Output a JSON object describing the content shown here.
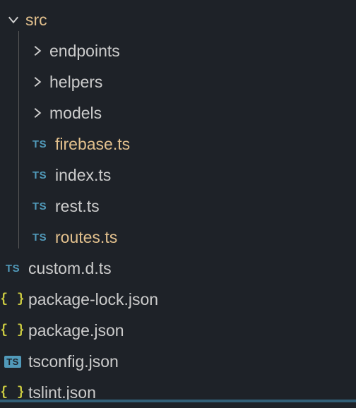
{
  "tree": {
    "src": {
      "label": "src",
      "folders": [
        {
          "label": "endpoints"
        },
        {
          "label": "helpers"
        },
        {
          "label": "models"
        }
      ],
      "files": [
        {
          "label": "firebase.ts",
          "icon": "ts",
          "highlight": true
        },
        {
          "label": "index.ts",
          "icon": "ts",
          "highlight": false
        },
        {
          "label": "rest.ts",
          "icon": "ts",
          "highlight": false
        },
        {
          "label": "routes.ts",
          "icon": "ts",
          "highlight": true
        }
      ]
    },
    "rootFiles": [
      {
        "label": "custom.d.ts",
        "icon": "ts"
      },
      {
        "label": "package-lock.json",
        "icon": "json"
      },
      {
        "label": "package.json",
        "icon": "json"
      },
      {
        "label": "tsconfig.json",
        "icon": "ts-badge"
      },
      {
        "label": "tslint.json",
        "icon": "json"
      }
    ]
  },
  "iconText": {
    "ts": "TS",
    "tsBadge": "TS",
    "json": "{ }"
  }
}
